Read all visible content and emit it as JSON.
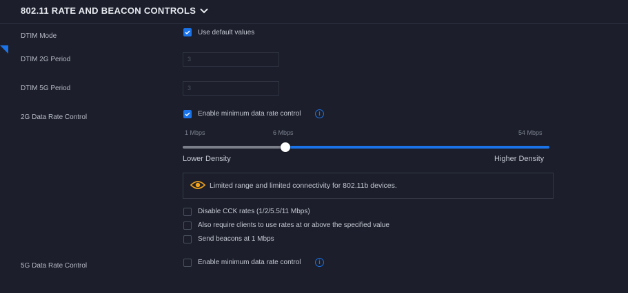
{
  "section": {
    "title": "802.11 RATE AND BEACON CONTROLS",
    "collapse_icon": "chevron-down-icon"
  },
  "dtim_mode": {
    "label": "DTIM Mode",
    "checkbox_label": "Use default values",
    "checked": true
  },
  "dtim_2g": {
    "label": "DTIM 2G Period",
    "value": "3"
  },
  "dtim_5g": {
    "label": "DTIM 5G Period",
    "value": "3"
  },
  "rate_2g": {
    "label": "2G Data Rate Control",
    "checkbox_label": "Enable minimum data rate control",
    "checked": true,
    "slider": {
      "min_label": "1 Mbps",
      "current_label": "6 Mbps",
      "max_label": "54 Mbps",
      "value_mbps": 6
    },
    "low_label": "Lower Density",
    "high_label": "Higher Density",
    "notice": {
      "icon": "eye-icon",
      "text": "Limited range and limited connectivity for 802.11b devices."
    },
    "options": [
      {
        "label": "Disable CCK rates (1/2/5.5/11 Mbps)",
        "checked": false
      },
      {
        "label": "Also require clients to use rates at or above the specified value",
        "checked": false
      },
      {
        "label": "Send beacons at 1 Mbps",
        "checked": false
      }
    ]
  },
  "rate_5g": {
    "label": "5G Data Rate Control",
    "checkbox_label": "Enable minimum data rate control",
    "checked": false
  },
  "colors": {
    "accent": "#1a73e8",
    "background": "#1c1f2b",
    "warning": "#f2a31b"
  }
}
